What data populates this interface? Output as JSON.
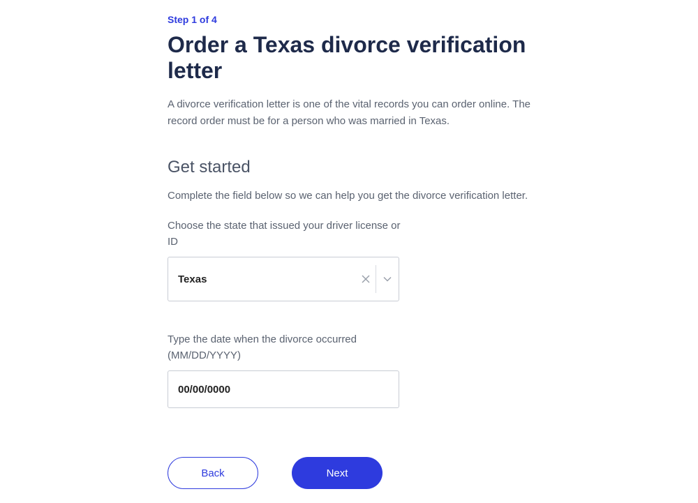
{
  "step": {
    "indicator": "Step 1 of 4"
  },
  "header": {
    "title": "Order a Texas divorce verification letter",
    "description": "A divorce verification letter is one of the vital records you can order online. The record order must be for a person who was married in Texas."
  },
  "form": {
    "heading": "Get started",
    "description": "Complete the field below so we can help you get the divorce verification letter.",
    "state_field": {
      "label": "Choose the state that issued your driver license or ID",
      "selected": "Texas"
    },
    "date_field": {
      "label": "Type the date when the divorce occurred (MM/DD/YYYY)",
      "placeholder": "00/00/0000",
      "value": ""
    }
  },
  "buttons": {
    "back": "Back",
    "next": "Next"
  }
}
